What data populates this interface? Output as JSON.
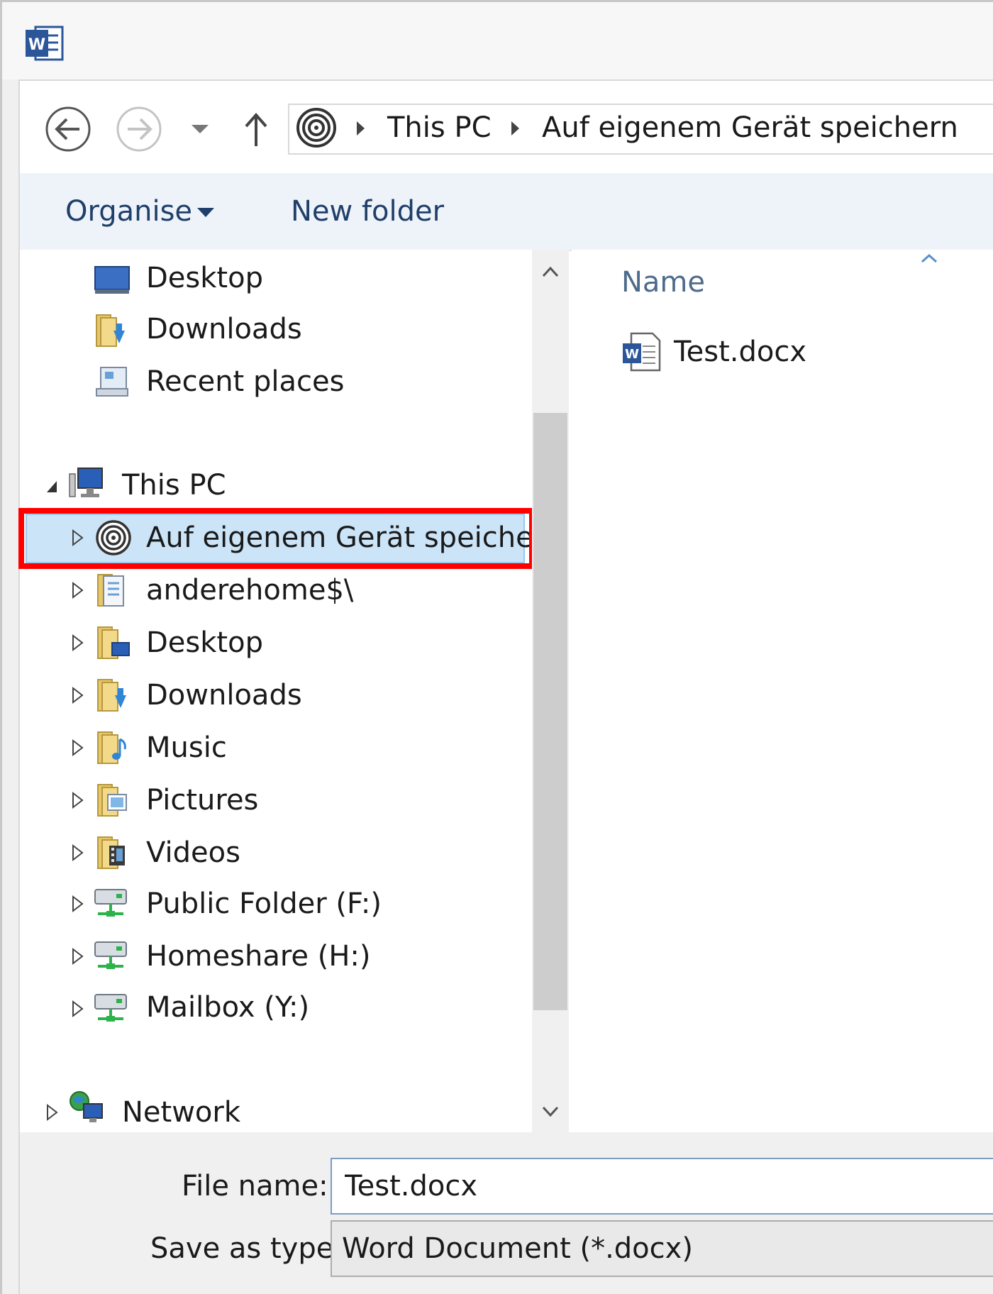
{
  "window": {
    "app_icon": "word-icon"
  },
  "nav": {
    "back_icon": "back-arrow-icon",
    "forward_icon": "forward-arrow-icon",
    "recent_icon": "chevron-down-icon",
    "up_icon": "up-arrow-icon",
    "breadcrumb": [
      "This PC",
      "Auf eigenem Gerät speichern"
    ]
  },
  "toolbar": {
    "organise_label": "Organise",
    "new_folder_label": "New folder"
  },
  "navpane": {
    "favourites": [
      {
        "label": "Desktop",
        "icon": "desktop-icon"
      },
      {
        "label": "Downloads",
        "icon": "downloads-folder-icon"
      },
      {
        "label": "Recent places",
        "icon": "recent-places-icon"
      }
    ],
    "this_pc": {
      "label": "This PC",
      "icon": "computer-icon"
    },
    "this_pc_items": [
      {
        "label": "Auf eigenem Gerät speichern",
        "icon": "spiral-drive-icon",
        "selected": true
      },
      {
        "label": "anderehome$\\",
        "icon": "network-folder-icon"
      },
      {
        "label": "Desktop",
        "icon": "desktop-folder-icon"
      },
      {
        "label": "Downloads",
        "icon": "downloads-folder-icon"
      },
      {
        "label": "Music",
        "icon": "music-folder-icon"
      },
      {
        "label": "Pictures",
        "icon": "pictures-folder-icon"
      },
      {
        "label": "Videos",
        "icon": "videos-folder-icon"
      },
      {
        "label": "Public Folder (F:)",
        "icon": "network-drive-icon"
      },
      {
        "label": "Homeshare (H:)",
        "icon": "network-drive-icon"
      },
      {
        "label": "Mailbox (Y:)",
        "icon": "network-drive-icon"
      }
    ],
    "network": {
      "label": "Network",
      "icon": "network-icon"
    }
  },
  "filelist": {
    "column_name": "Name",
    "files": [
      {
        "name": "Test.docx",
        "icon": "word-document-icon"
      }
    ]
  },
  "form": {
    "file_name_label": "File name:",
    "file_name_value": "Test.docx",
    "save_type_label": "Save as type:",
    "save_type_value": "Word Document (*.docx)"
  },
  "colors": {
    "selection": "#cce4f7",
    "highlight": "#ff0000",
    "link": "#1f3f6a"
  }
}
